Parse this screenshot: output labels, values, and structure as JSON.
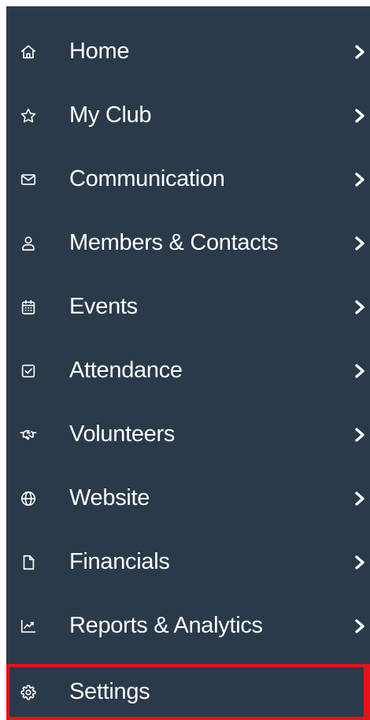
{
  "sidebar": {
    "items": [
      {
        "label": "Home",
        "icon": "home-icon"
      },
      {
        "label": "My Club",
        "icon": "star-icon"
      },
      {
        "label": "Communication",
        "icon": "envelope-icon"
      },
      {
        "label": "Members & Contacts",
        "icon": "user-icon"
      },
      {
        "label": "Events",
        "icon": "calendar-icon"
      },
      {
        "label": "Attendance",
        "icon": "checkbox-icon"
      },
      {
        "label": "Volunteers",
        "icon": "handshake-icon"
      },
      {
        "label": "Website",
        "icon": "globe-icon"
      },
      {
        "label": "Financials",
        "icon": "document-icon"
      },
      {
        "label": "Reports & Analytics",
        "icon": "chart-icon"
      }
    ],
    "settings": {
      "label": "Settings",
      "icon": "gear-icon",
      "highlight_color": "#e3141b"
    },
    "background_color": "#2b3a4a",
    "text_color": "#ffffff"
  }
}
